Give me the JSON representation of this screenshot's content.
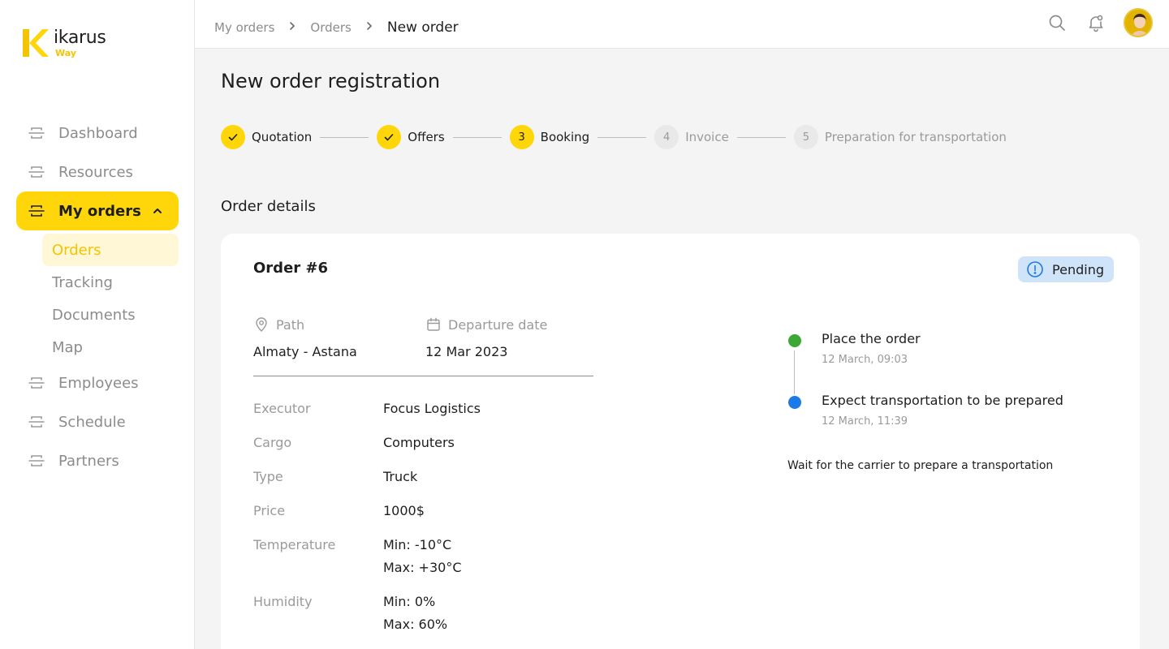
{
  "brand": {
    "name": "ikarus",
    "sub": "Way",
    "accent": "#FFD60A"
  },
  "sidebar": {
    "items": [
      {
        "label": "Dashboard",
        "icon": "list-icon"
      },
      {
        "label": "Resources",
        "icon": "list-icon"
      },
      {
        "label": "My orders",
        "icon": "list-icon",
        "active": true,
        "expanded": true,
        "children": [
          {
            "label": "Orders",
            "active": true
          },
          {
            "label": "Tracking"
          },
          {
            "label": "Documents"
          },
          {
            "label": "Map"
          }
        ]
      },
      {
        "label": "Employees",
        "icon": "list-icon"
      },
      {
        "label": "Schedule",
        "icon": "list-icon"
      },
      {
        "label": "Partners",
        "icon": "list-icon"
      }
    ]
  },
  "header": {
    "breadcrumb": [
      "My orders",
      "Orders",
      "New order"
    ],
    "icons": [
      "search-icon",
      "bell-icon",
      "avatar"
    ]
  },
  "page": {
    "title": "New order registration",
    "steps": [
      {
        "label": "Quotation",
        "status": "done",
        "marker": "✓"
      },
      {
        "label": "Offers",
        "status": "done",
        "marker": "✓"
      },
      {
        "label": "Booking",
        "status": "current",
        "marker": "3"
      },
      {
        "label": "Invoice",
        "status": "pending",
        "marker": "4"
      },
      {
        "label": "Preparation for transportation",
        "status": "pending",
        "marker": "5"
      }
    ],
    "section_title": "Order details"
  },
  "order": {
    "title": "Order #6",
    "status": "Pending",
    "status_color": "#CFE3F9",
    "path_label": "Path",
    "path_value": "Almaty - Astana",
    "departure_label": "Departure date",
    "departure_value": "12 Mar 2023",
    "details": [
      {
        "key": "Executor",
        "lines": [
          "Focus Logistics"
        ]
      },
      {
        "key": "Cargo",
        "lines": [
          "Computers"
        ]
      },
      {
        "key": "Type",
        "lines": [
          "Truck"
        ]
      },
      {
        "key": "Price",
        "lines": [
          "1000$"
        ]
      },
      {
        "key": "Temperature",
        "lines": [
          "Min: -10°C",
          "Max: +30°C"
        ]
      },
      {
        "key": "Humidity",
        "lines": [
          "Min: 0%",
          "Max: 60%"
        ]
      }
    ],
    "timeline": [
      {
        "title": "Place the order",
        "time": "12 March, 09:03",
        "color": "#3DA836"
      },
      {
        "title": "Expect transportation to be prepared",
        "time": "12 March, 11:39",
        "color": "#1E7BE6"
      }
    ],
    "note": "Wait for the carrier to prepare a transportation"
  }
}
